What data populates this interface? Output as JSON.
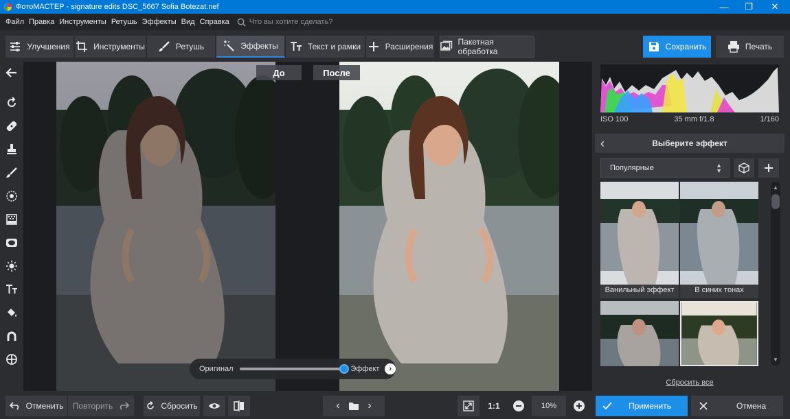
{
  "titlebar": {
    "title": "ФотоМАСТЕР - signature edits  DSC_5667 Sofia Botezat.nef",
    "minimize": "—",
    "maximize": "❐",
    "close": "✕"
  },
  "menu": {
    "items": [
      "Файл",
      "Правка",
      "Инструменты",
      "Ретушь",
      "Эффекты",
      "Вид",
      "Справка"
    ],
    "search_placeholder": "Что вы хотите сделать?"
  },
  "tabs": [
    {
      "label": "Улучшения",
      "icon": "sliders-icon"
    },
    {
      "label": "Инструменты",
      "icon": "crop-icon"
    },
    {
      "label": "Ретушь",
      "icon": "brush-icon"
    },
    {
      "label": "Эффекты",
      "icon": "magic-wand-icon",
      "active": true
    },
    {
      "label": "Текст и рамки",
      "icon": "text-icon"
    },
    {
      "label": "Расширения",
      "icon": "plus-icon"
    }
  ],
  "batch_label": "Пакетная обработка",
  "save_label": "Сохранить",
  "print_label": "Печать",
  "compare": {
    "before": "До",
    "after": "После",
    "slider_left": "Оригинал",
    "slider_right": "Эффект",
    "slider_value": 1.0
  },
  "histogram": {
    "iso": "ISO 100",
    "lens": "35 mm f/1.8",
    "shutter": "1/160"
  },
  "effects_panel": {
    "header": "Выберите эффект",
    "category": "Популярные",
    "thumbs": [
      {
        "label": "Ванильный эффект"
      },
      {
        "label": "В синих тонах"
      },
      {
        "label": ""
      },
      {
        "label": ""
      }
    ],
    "reset_all": "Сбросить все"
  },
  "bottom": {
    "undo": "Отменить",
    "redo": "Повторить",
    "reset": "Сбросить",
    "zoom_fit": "1:1",
    "zoom": "10%",
    "apply": "Применить",
    "cancel": "Отмена"
  },
  "colors": {
    "accent": "#1e8fe8",
    "panel": "#2b2d31",
    "button": "#3a3c41"
  }
}
